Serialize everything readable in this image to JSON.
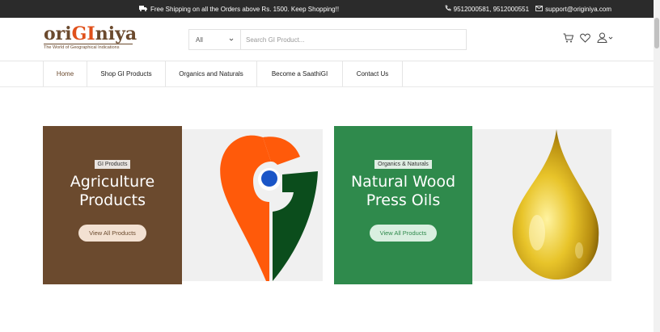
{
  "topbar": {
    "shipping_text": "Free Shipping on all the Orders above Rs. 1500.  Keep Shopping!!",
    "phones": "9512000581, 9512000551",
    "email": "support@originiya.com"
  },
  "header": {
    "logo_ori": "ori",
    "logo_gi": "GI",
    "logo_niya": "niya",
    "logo_tagline": "The World of Geographical Indications",
    "search_category": "All",
    "search_placeholder": "Search GI Product..."
  },
  "nav": {
    "items": [
      {
        "label": "Home"
      },
      {
        "label": "Shop GI Products"
      },
      {
        "label": "Organics and Naturals"
      },
      {
        "label": "Become a SaathiGI"
      },
      {
        "label": "Contact Us"
      }
    ]
  },
  "banners": [
    {
      "badge": "GI Products",
      "title_line1": "Agriculture",
      "title_line2": "Products",
      "button": "View All Products",
      "bg_color": "#6b4a2e"
    },
    {
      "badge": "Organics & Naturals",
      "title_line1": "Natural Wood",
      "title_line2": "Press Oils",
      "button": "View All Products",
      "bg_color": "#2f8a4c"
    }
  ],
  "icons": [
    "truck-icon",
    "phone-icon",
    "mail-icon",
    "cart-icon",
    "heart-icon",
    "user-icon",
    "chevron-down-icon"
  ]
}
